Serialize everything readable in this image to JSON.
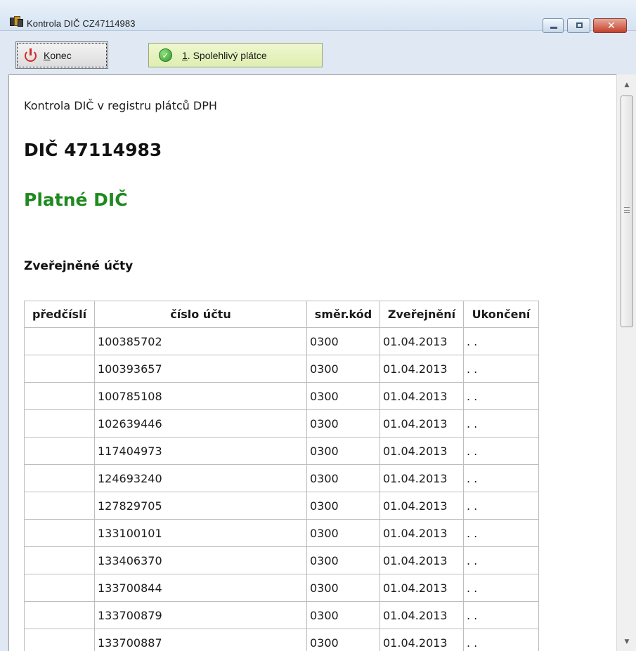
{
  "window": {
    "title": "Kontrola DIČ CZ47114983",
    "icon": "app-books-icon",
    "controls": {
      "minimize": "minimize-icon",
      "maximize": "maximize-icon",
      "close": "close-icon"
    }
  },
  "toolbar": {
    "konec": {
      "hotkey": "K",
      "rest": "onec",
      "icon": "power-icon",
      "icon_color": "#d12a2a"
    },
    "spolehlivy": {
      "hotkey": "1",
      "rest": ". Spolehlivý plátce",
      "icon": "check-icon",
      "icon_color": "#2f9a2f"
    }
  },
  "content": {
    "intro": "Kontrola DIČ v registru plátců DPH",
    "dic_heading": "DIČ 47114983",
    "status": "Platné DIČ",
    "status_color": "#1f8a1f",
    "accounts_heading": "Zveřejněné účty",
    "table": {
      "headers": [
        "předčíslí",
        "číslo účtu",
        "směr.kód",
        "Zveřejnění",
        "Ukončení"
      ],
      "rows": [
        [
          "",
          "100385702",
          "0300",
          "01.04.2013",
          ". ."
        ],
        [
          "",
          "100393657",
          "0300",
          "01.04.2013",
          ". ."
        ],
        [
          "",
          "100785108",
          "0300",
          "01.04.2013",
          ". ."
        ],
        [
          "",
          "102639446",
          "0300",
          "01.04.2013",
          ". ."
        ],
        [
          "",
          "117404973",
          "0300",
          "01.04.2013",
          ". ."
        ],
        [
          "",
          "124693240",
          "0300",
          "01.04.2013",
          ". ."
        ],
        [
          "",
          "127829705",
          "0300",
          "01.04.2013",
          ". ."
        ],
        [
          "",
          "133100101",
          "0300",
          "01.04.2013",
          ". ."
        ],
        [
          "",
          "133406370",
          "0300",
          "01.04.2013",
          ". ."
        ],
        [
          "",
          "133700844",
          "0300",
          "01.04.2013",
          ". ."
        ],
        [
          "",
          "133700879",
          "0300",
          "01.04.2013",
          ". ."
        ],
        [
          "",
          "133700887",
          "0300",
          "01.04.2013",
          ". ."
        ]
      ]
    }
  }
}
